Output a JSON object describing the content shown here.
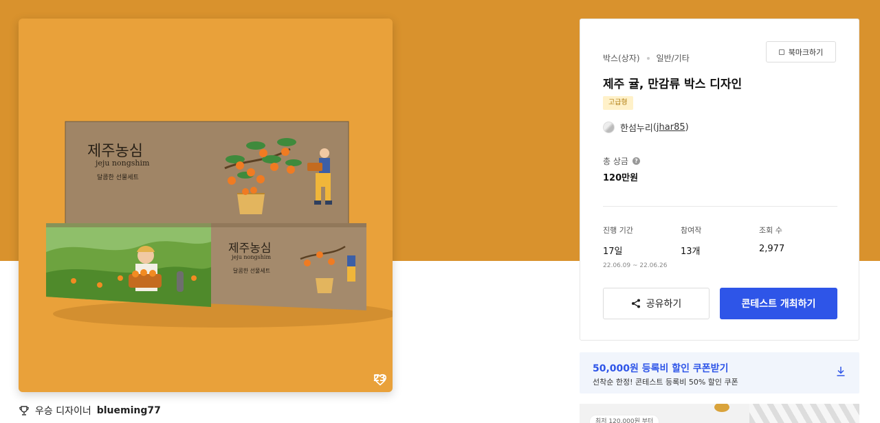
{
  "like_count": "23",
  "winner": {
    "label": "우승 디자이너",
    "name": "blueming77"
  },
  "product_art": {
    "brand_ko": "제주농심",
    "brand_en": "jeju nongshim",
    "tagline": "달콤한 선물세트"
  },
  "category": {
    "primary": "박스(상자)",
    "secondary": "일반/기타"
  },
  "bookmark_label": "북마크하기",
  "title": "제주 귤, 만감류 박스 디자인",
  "grade_badge": "고급형",
  "author": {
    "name": "한섬누리",
    "open": "(",
    "id": "jhar85",
    "close": ")"
  },
  "prize": {
    "label": "총 상금",
    "help_icon": "?",
    "value": "120만원"
  },
  "stats": {
    "period": {
      "label": "진행 기간",
      "value": "17일",
      "range": "22.06.09 ~ 22.06.26"
    },
    "participants": {
      "label": "참여작",
      "value": "13개"
    },
    "views": {
      "label": "조회 수",
      "value": "2,977"
    }
  },
  "share_label": "공유하기",
  "open_contest_label": "콘테스트 개최하기",
  "coupon": {
    "title": "50,000원 등록비 할인 쿠폰받기",
    "subtitle": "선착순 한정! 콘테스트 등록비 50% 할인 쿠폰"
  },
  "promo_pill": "최저 120,000원 부터",
  "colors": {
    "band": "#d9922d",
    "hero_bg": "#e9a13a",
    "primary": "#2e55e8",
    "grade_bg": "#fff1c9",
    "coupon_bg": "#f1f5fc"
  },
  "icons": [
    "heart-icon",
    "trophy-icon",
    "bookmark-icon",
    "help-icon",
    "share-icon",
    "download-icon",
    "avatar"
  ]
}
